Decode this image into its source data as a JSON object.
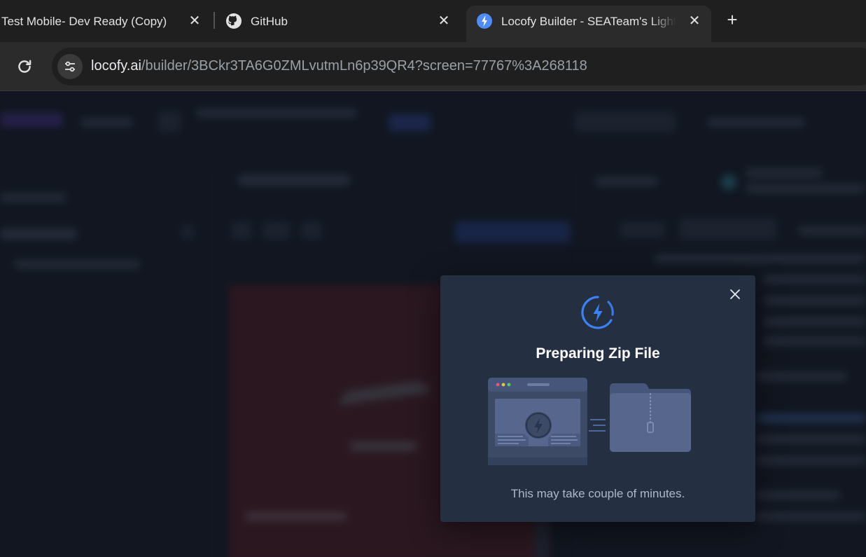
{
  "browser": {
    "tabs": [
      {
        "title": "Test Mobile- Dev Ready (Copy)",
        "active": false
      },
      {
        "title": "GitHub",
        "active": false,
        "icon": "github-icon"
      },
      {
        "title": "Locofy Builder - SEATeam's Lighthouse",
        "active": true,
        "icon": "locofy-bolt-icon"
      }
    ],
    "url_host": "locofy.ai",
    "url_path": "/builder/3BCkr3TA6G0ZMLvutmLn6p39QR4?screen=77767%3A268118"
  },
  "modal": {
    "title": "Preparing Zip File",
    "subtitle": "This may take couple of minutes.",
    "accent": "#3b82f6"
  }
}
